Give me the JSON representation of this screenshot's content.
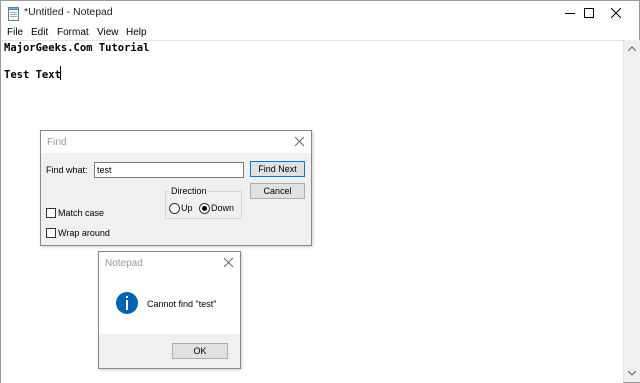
{
  "window": {
    "title": "*Untitled - Notepad",
    "controls": [
      "minimize",
      "maximize",
      "close"
    ]
  },
  "menu": [
    "File",
    "Edit",
    "Format",
    "View",
    "Help"
  ],
  "editor": {
    "lines": [
      "MajorGeeks.Com Tutorial",
      "",
      "Test Text"
    ]
  },
  "find_dialog": {
    "title": "Find",
    "find_what_label": "Find what:",
    "find_what_value": "test",
    "find_next_label": "Find Next",
    "cancel_label": "Cancel",
    "direction_label": "Direction",
    "up_label": "Up",
    "down_label": "Down",
    "direction_selected": "Down",
    "match_case_label": "Match case",
    "match_case_checked": false,
    "wrap_around_label": "Wrap around",
    "wrap_around_checked": false
  },
  "message_box": {
    "title": "Notepad",
    "message": "Cannot find \"test\"",
    "ok_label": "OK",
    "icon": "info-icon",
    "icon_color": "#0063b1"
  }
}
